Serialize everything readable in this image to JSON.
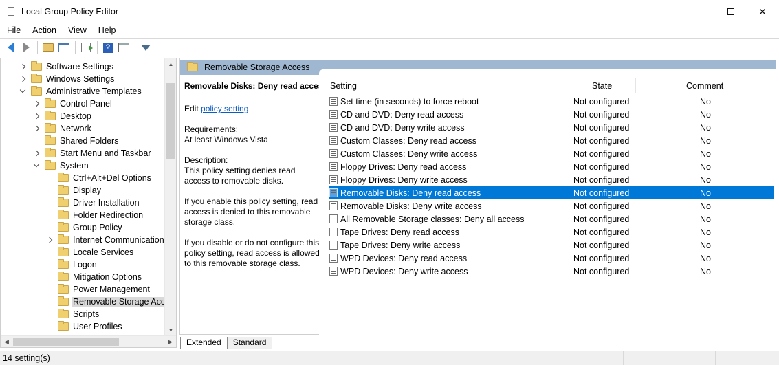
{
  "window": {
    "title": "Local Group Policy Editor",
    "controls": {
      "minimize": "minimize",
      "maximize": "maximize",
      "close": "✕"
    }
  },
  "menu": [
    "File",
    "Action",
    "View",
    "Help"
  ],
  "toolbar": {
    "icons": [
      "back-icon",
      "forward-icon",
      "up-folder-icon",
      "show-hide-tree-icon",
      "export-list-icon",
      "help-icon",
      "properties-icon",
      "filter-icon"
    ]
  },
  "tree": [
    {
      "label": "Software Settings",
      "depth": 1,
      "expander": "collapsed"
    },
    {
      "label": "Windows Settings",
      "depth": 1,
      "expander": "collapsed"
    },
    {
      "label": "Administrative Templates",
      "depth": 1,
      "expander": "expanded"
    },
    {
      "label": "Control Panel",
      "depth": 2,
      "expander": "collapsed"
    },
    {
      "label": "Desktop",
      "depth": 2,
      "expander": "collapsed"
    },
    {
      "label": "Network",
      "depth": 2,
      "expander": "collapsed"
    },
    {
      "label": "Shared Folders",
      "depth": 2,
      "expander": "none"
    },
    {
      "label": "Start Menu and Taskbar",
      "depth": 2,
      "expander": "collapsed"
    },
    {
      "label": "System",
      "depth": 2,
      "expander": "expanded"
    },
    {
      "label": "Ctrl+Alt+Del Options",
      "depth": 3,
      "expander": "none"
    },
    {
      "label": "Display",
      "depth": 3,
      "expander": "none"
    },
    {
      "label": "Driver Installation",
      "depth": 3,
      "expander": "none"
    },
    {
      "label": "Folder Redirection",
      "depth": 3,
      "expander": "none"
    },
    {
      "label": "Group Policy",
      "depth": 3,
      "expander": "none"
    },
    {
      "label": "Internet Communication I",
      "depth": 3,
      "expander": "collapsed"
    },
    {
      "label": "Locale Services",
      "depth": 3,
      "expander": "none"
    },
    {
      "label": "Logon",
      "depth": 3,
      "expander": "none"
    },
    {
      "label": "Mitigation Options",
      "depth": 3,
      "expander": "none"
    },
    {
      "label": "Power Management",
      "depth": 3,
      "expander": "none"
    },
    {
      "label": "Removable Storage Acces",
      "depth": 3,
      "expander": "none",
      "selected": true
    },
    {
      "label": "Scripts",
      "depth": 3,
      "expander": "none"
    },
    {
      "label": "User Profiles",
      "depth": 3,
      "expander": "none"
    }
  ],
  "pane_header": "Removable Storage Access",
  "description": {
    "title": "Removable Disks: Deny read access",
    "edit_prefix": "Edit",
    "edit_link": "policy setting",
    "requirements_label": "Requirements:",
    "requirements": "At least Windows Vista",
    "description_label": "Description:",
    "description": "This policy setting denies read access to removable disks.",
    "enable_text": "If you enable this policy setting, read access is denied to this removable storage class.",
    "disable_text": "If you disable or do not configure this policy setting, read access is allowed to this removable storage class."
  },
  "columns": {
    "setting": "Setting",
    "state": "State",
    "comment": "Comment"
  },
  "settings": [
    {
      "name": "Set time (in seconds) to force reboot",
      "state": "Not configured",
      "comment": "No"
    },
    {
      "name": "CD and DVD: Deny read access",
      "state": "Not configured",
      "comment": "No"
    },
    {
      "name": "CD and DVD: Deny write access",
      "state": "Not configured",
      "comment": "No"
    },
    {
      "name": "Custom Classes: Deny read access",
      "state": "Not configured",
      "comment": "No"
    },
    {
      "name": "Custom Classes: Deny write access",
      "state": "Not configured",
      "comment": "No"
    },
    {
      "name": "Floppy Drives: Deny read access",
      "state": "Not configured",
      "comment": "No"
    },
    {
      "name": "Floppy Drives: Deny write access",
      "state": "Not configured",
      "comment": "No"
    },
    {
      "name": "Removable Disks: Deny read access",
      "state": "Not configured",
      "comment": "No",
      "selected": true
    },
    {
      "name": "Removable Disks: Deny write access",
      "state": "Not configured",
      "comment": "No"
    },
    {
      "name": "All Removable Storage classes: Deny all access",
      "state": "Not configured",
      "comment": "No"
    },
    {
      "name": "Tape Drives: Deny read access",
      "state": "Not configured",
      "comment": "No"
    },
    {
      "name": "Tape Drives: Deny write access",
      "state": "Not configured",
      "comment": "No"
    },
    {
      "name": "WPD Devices: Deny read access",
      "state": "Not configured",
      "comment": "No"
    },
    {
      "name": "WPD Devices: Deny write access",
      "state": "Not configured",
      "comment": "No"
    }
  ],
  "tabs": [
    "Extended",
    "Standard"
  ],
  "status": "14 setting(s)",
  "colors": {
    "selection": "#0078d7",
    "header_band": "#9fb7d0",
    "link": "#0b5cc5"
  }
}
